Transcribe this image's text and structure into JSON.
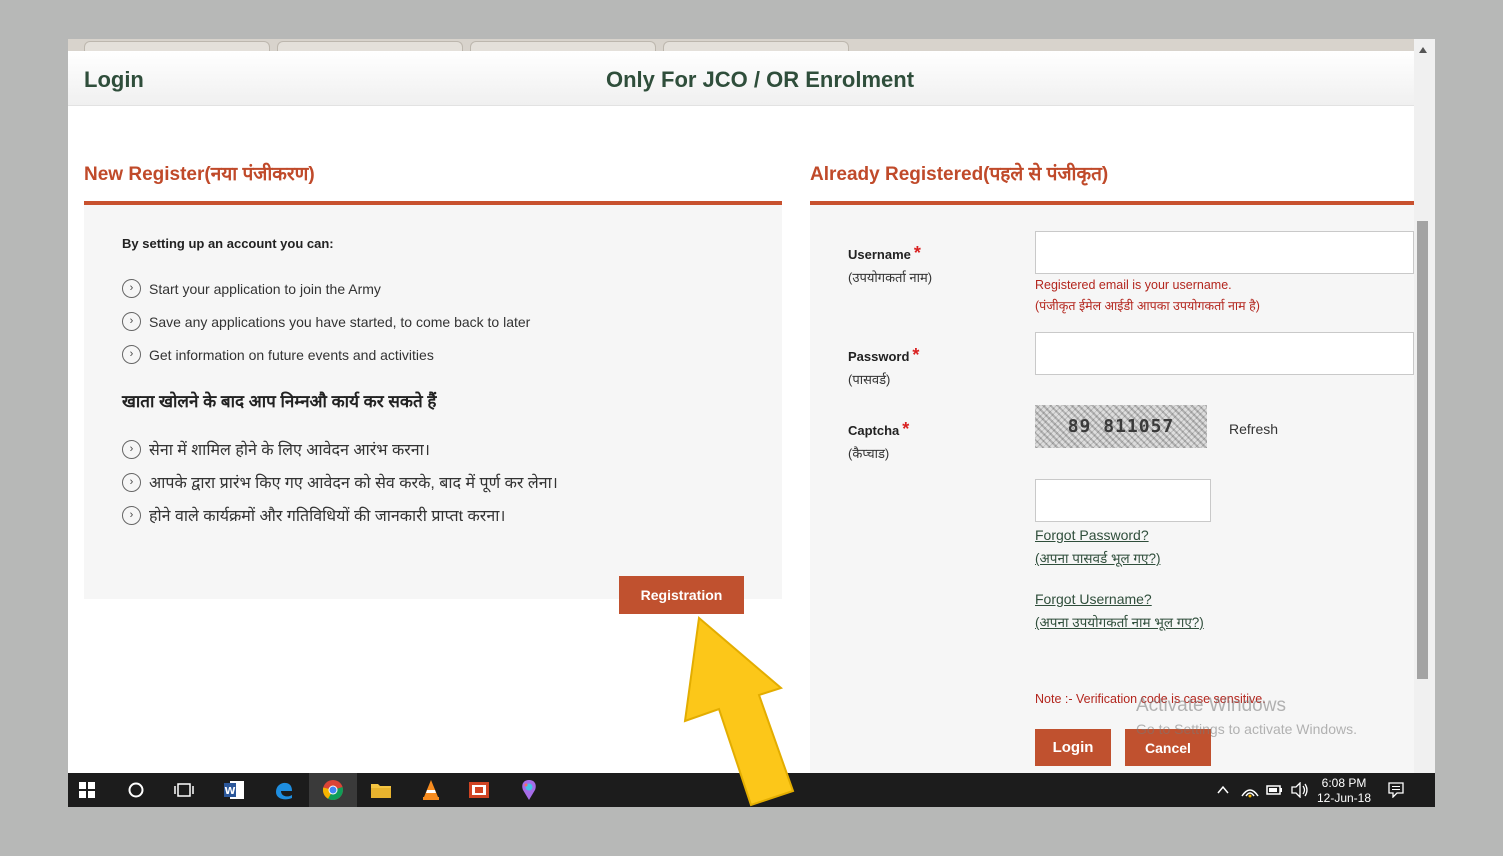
{
  "header": {
    "login_title": "Login",
    "enrolment_title": "Only For JCO / OR Enrolment"
  },
  "new_register": {
    "title": "New Register(नया पंजीकरण)",
    "intro_en": "By setting up an account you can:",
    "bullets_en": [
      "Start your application to join the Army",
      "Save any applications you have started, to come back to later",
      "Get information on future events and activities"
    ],
    "intro_hi": "खाता खोलने के बाद आप निम्नऔ कार्य कर सकते हैं",
    "bullets_hi": [
      "सेना में शामिल होने के लिए आवेदन आरंभ करना।",
      "आपके द्वारा प्रारंभ किए गए आवेदन को सेव करके, बाद में पूर्ण कर लेना।",
      "होने वाले कार्यक्रमों और गतिविधियों की जानकारी प्राप्तt करना।"
    ],
    "registration_button": "Registration"
  },
  "already_registered": {
    "title": "Already Registered(पहले से पंजीकृत)",
    "username_label": "Username",
    "username_label_hi": "(उपयोगकर्ता नाम)",
    "username_value": "",
    "username_hint": "Registered email is your username.",
    "username_hint_hi": "(पंजीकृत ईमेल आईडी आपका उपयोगकर्ता नाम है)",
    "password_label": "Password",
    "password_label_hi": "(पासवर्ड)",
    "password_value": "",
    "captcha_label": "Captcha",
    "captcha_label_hi": "(कैप्चाड)",
    "captcha_text": "89 811057",
    "refresh_label": "Refresh",
    "captcha_value": "",
    "required_mark": "*",
    "forgot_password": "Forgot Password?",
    "forgot_password_hi": "(अपना पासवर्ड भूल गए?)",
    "forgot_username": "Forgot Username?",
    "forgot_username_hi": "(अपना उपयोगकर्ता नाम भूल गए?)",
    "note": "Note :- Verification code is case sensitive.",
    "login_button": "Login",
    "cancel_button": "Cancel"
  },
  "watermark": {
    "title": "Activate Windows",
    "subtitle": "Go to Settings to activate Windows."
  },
  "taskbar": {
    "time": "6:08 PM",
    "date": "12-Jun-18"
  },
  "colors": {
    "accent": "#c0512f",
    "heading": "#2f4e3b",
    "error": "#b3261e",
    "arrow": "#fcc719"
  }
}
